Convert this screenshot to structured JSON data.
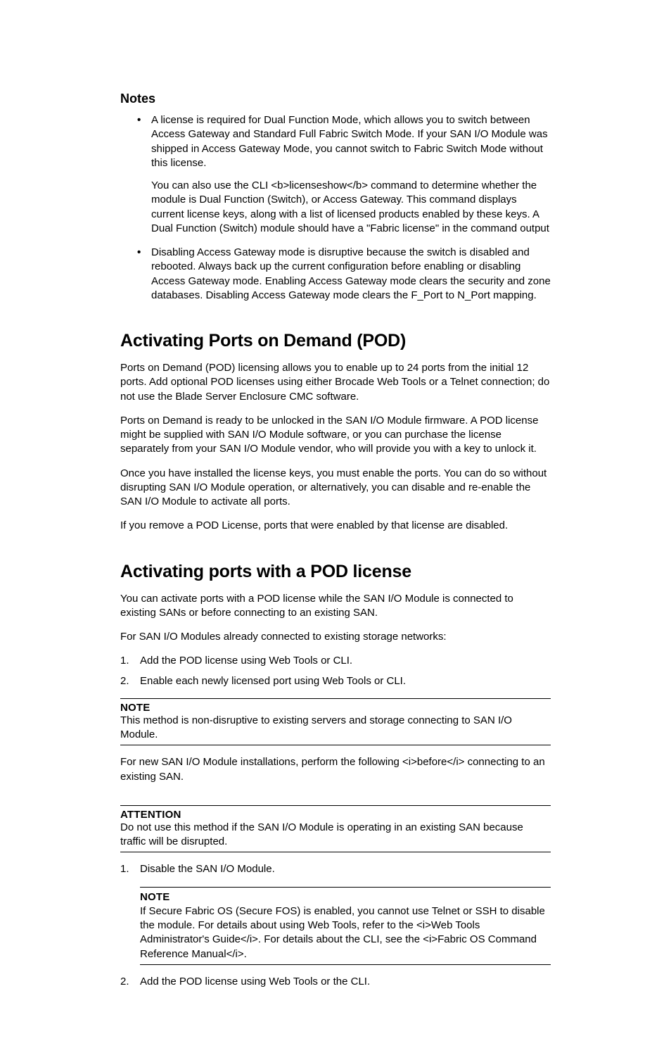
{
  "notes_heading": "Notes",
  "notes_bullets": [
    {
      "paras": [
        "A license is required for Dual Function Mode, which allows you to switch between Access Gateway and Standard Full Fabric Switch Mode. If your SAN I/O Module was shipped in Access Gateway Mode, you cannot switch to Fabric Switch Mode without this license.",
        "You can also use the CLI <b>licenseshow</b> command to determine whether the module is Dual Function (Switch), or Access Gateway. This command displays current license keys, along with a list of licensed products enabled by these keys. A Dual Function (Switch) module should have a \"Fabric license\" in the command output"
      ]
    },
    {
      "paras": [
        "Disabling Access Gateway mode is disruptive because the switch is disabled and rebooted. Always back up the current configuration before enabling or disabling Access Gateway mode. Enabling Access Gateway mode clears the security and zone databases. Disabling Access Gateway mode clears the F_Port to N_Port mapping."
      ]
    }
  ],
  "pod_heading": "Activating Ports on Demand (POD)",
  "pod_paras": [
    "Ports on Demand (POD) licensing allows you to enable up to 24 ports from the initial 12 ports. Add optional POD licenses using either Brocade Web Tools or a Telnet connection; do not use the Blade Server Enclosure CMC software.",
    "Ports on Demand is ready to be unlocked in the SAN I/O Module firmware. A POD license might be supplied with SAN I/O Module software, or you can purchase the license separately from your SAN I/O Module vendor, who will provide you with a key to unlock it.",
    "Once you have installed the license keys, you must enable the ports. You can do so without disrupting SAN I/O Module operation, or alternatively, you can disable and re-enable the SAN I/O Module to activate all ports.",
    "If you remove a POD License, ports that were enabled by that license are disabled."
  ],
  "act_heading": "Activating ports with a POD license",
  "act_intro": "You can activate ports with a POD license while the SAN I/O Module is connected to existing SANs or before connecting to an existing SAN.",
  "act_line2": "For SAN I/O Modules already connected to existing storage networks:",
  "act_list1": [
    "Add the POD license using Web Tools or CLI.",
    "Enable each newly licensed port using Web Tools or CLI."
  ],
  "note1_label": "NOTE",
  "note1_text": "This method is non-disruptive to existing servers and storage connecting to SAN I/O Module.",
  "act_line3_html": "For new SAN I/O Module installations, perform the following <i>before</i> connecting to an existing SAN.",
  "attn_label": "ATTENTION",
  "attn_text": "Do not use this method if the SAN I/O Module is operating in an existing SAN because traffic will be disrupted.",
  "act_list2_item1": "Disable the SAN I/O Module.",
  "note2_label": "NOTE",
  "note2_text_html": "If Secure Fabric OS (Secure FOS) is enabled, you cannot use Telnet or SSH to disable the module. For details about using Web Tools, refer to the <i>Web Tools Administrator's Guide</i>. For details about the CLI, see the <i>Fabric OS Command Reference Manual</i>.",
  "act_list2_item2": "Add the POD license using Web Tools or the CLI."
}
